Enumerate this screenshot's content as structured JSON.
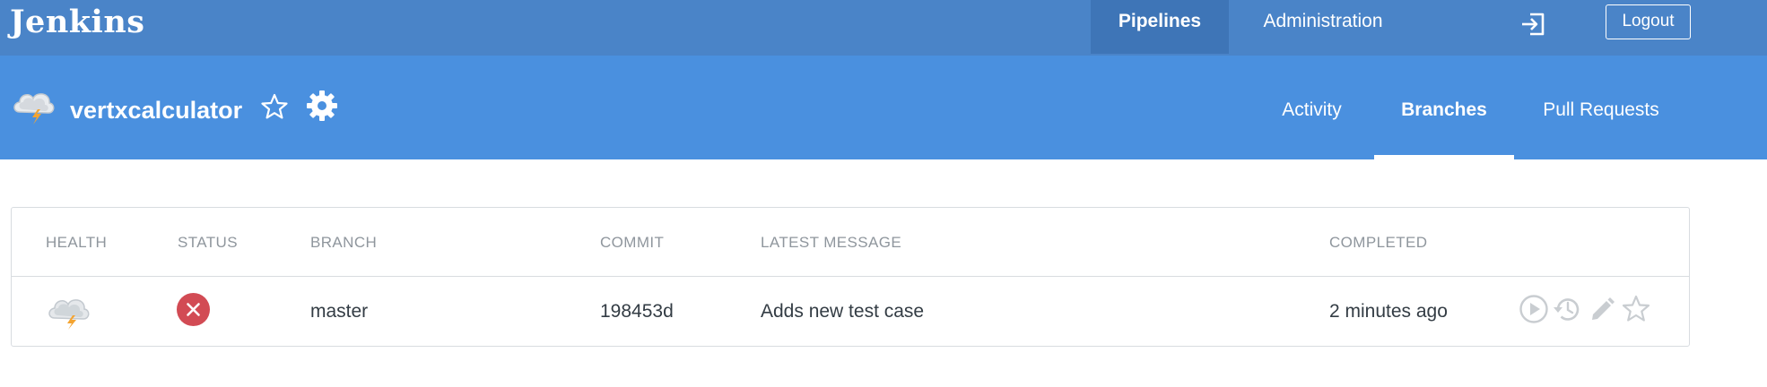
{
  "topbar": {
    "brand": "Jenkins",
    "nav": [
      "Pipelines",
      "Administration"
    ],
    "logout_label": "Logout",
    "colors": {
      "bar": "#4a84c8",
      "active": "#3e75b7"
    }
  },
  "header": {
    "pipeline_name": "vertxcalculator",
    "tabs": [
      "Activity",
      "Branches",
      "Pull Requests"
    ],
    "active_tab": "Branches",
    "colors": {
      "header": "#4a90df"
    }
  },
  "table": {
    "columns": [
      "HEALTH",
      "STATUS",
      "BRANCH",
      "COMMIT",
      "LATEST MESSAGE",
      "COMPLETED"
    ],
    "rows": [
      {
        "health_icon": "cloud-lightning-icon",
        "status_icon": "failure-x-icon",
        "branch": "master",
        "commit": "198453d",
        "message": "Adds new test case",
        "completed": "2 minutes ago",
        "actions": [
          "run-icon",
          "history-icon",
          "edit-icon",
          "star-icon"
        ]
      }
    ],
    "colors": {
      "failure": "#d24b54",
      "muted": "#8f969d",
      "action": "#c9cdd1"
    }
  }
}
